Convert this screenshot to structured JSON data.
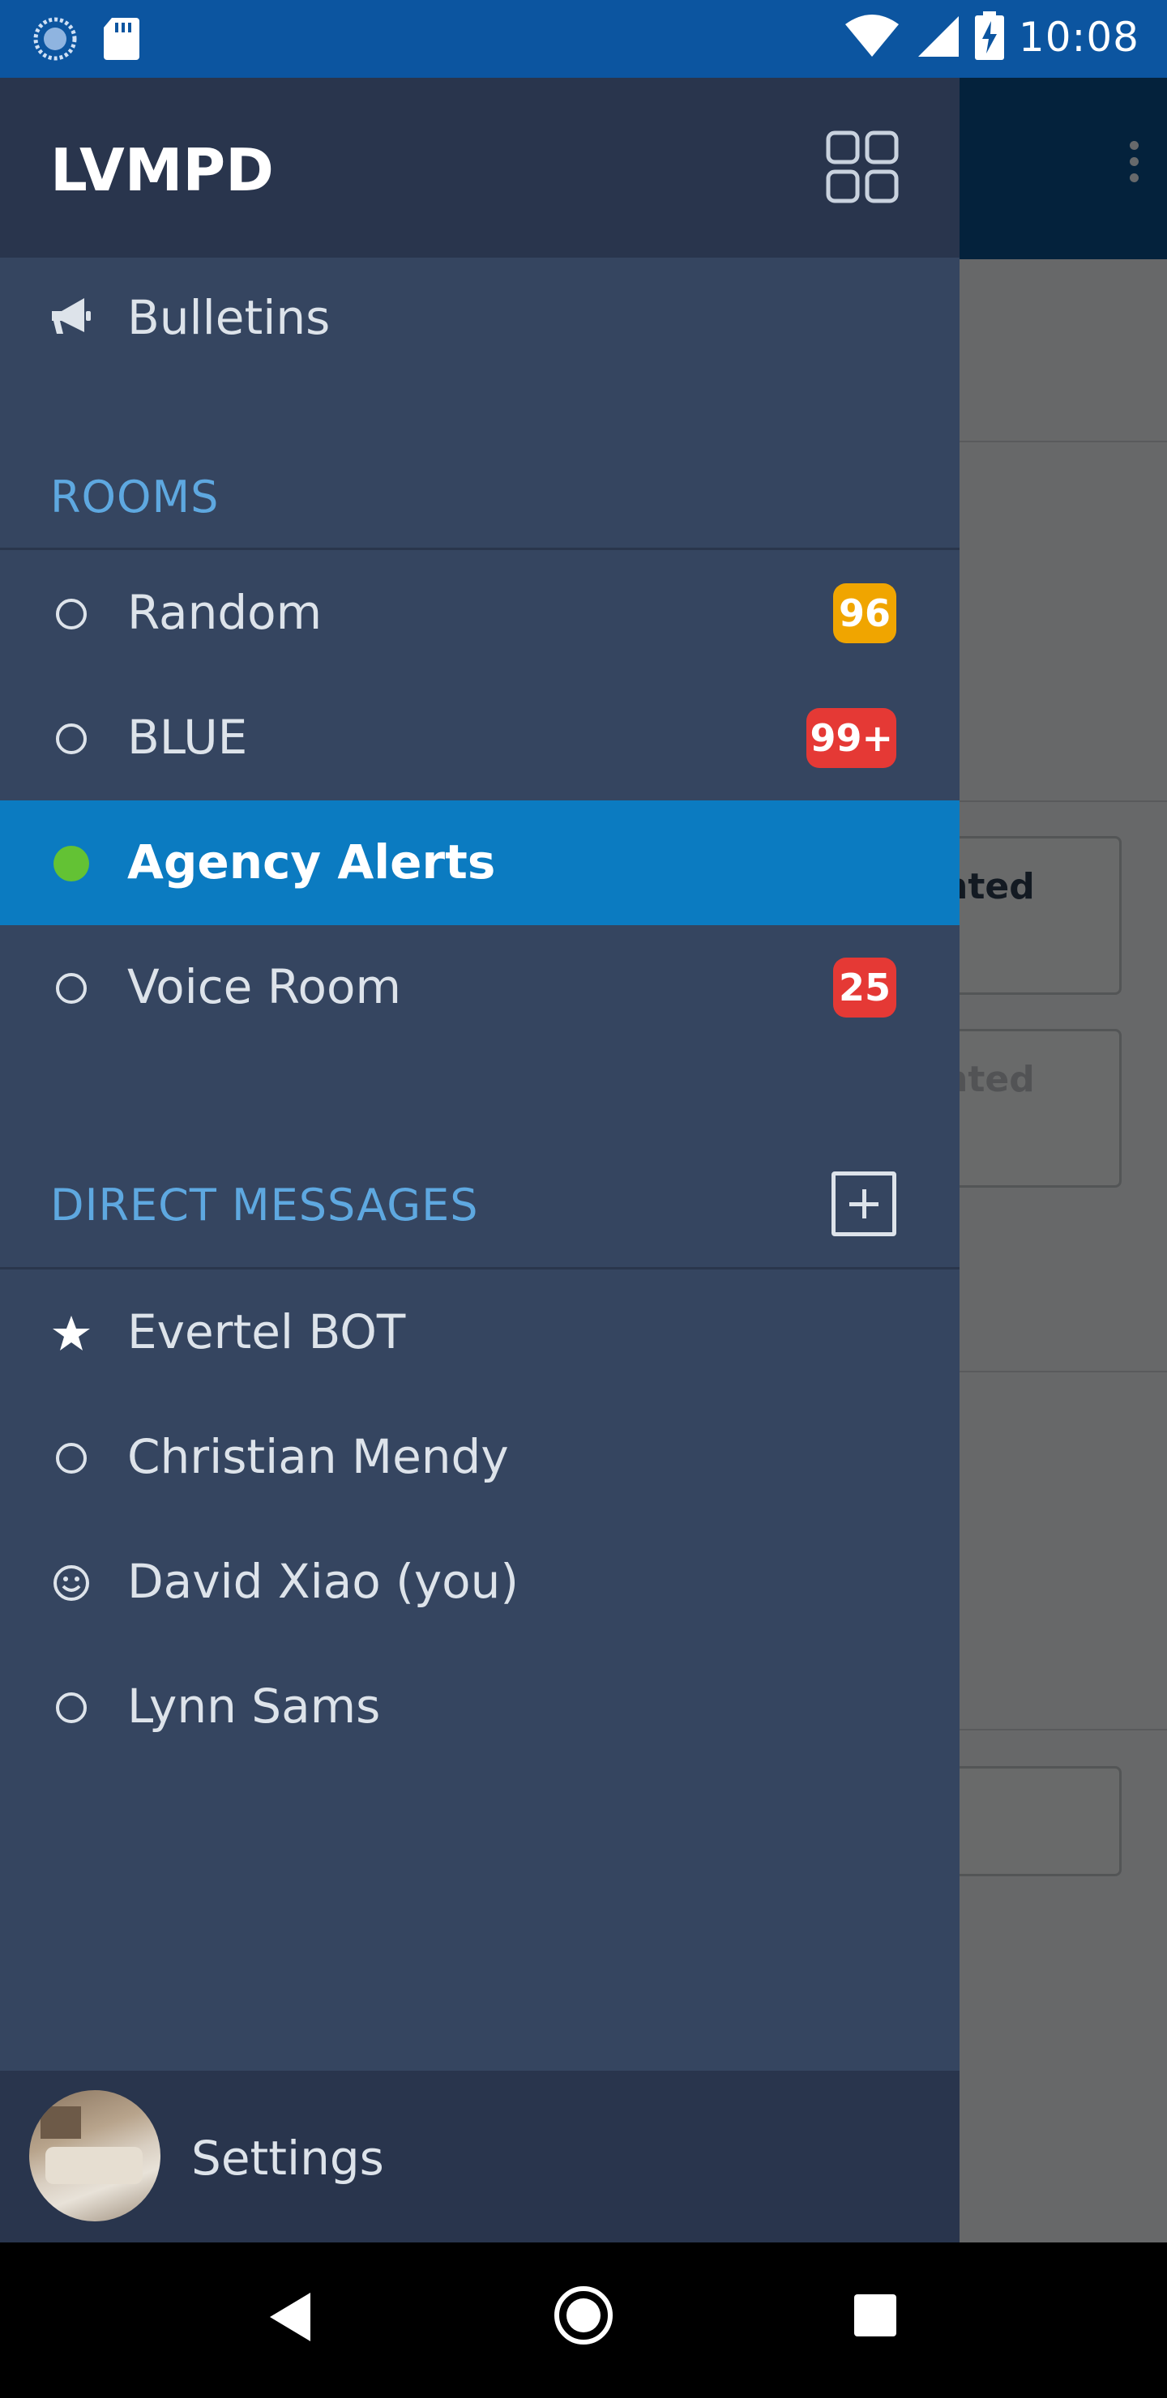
{
  "status_bar": {
    "time": "10:08",
    "icons": [
      "sync-icon",
      "sd-card-icon",
      "wifi-icon",
      "signal-icon",
      "battery-charging-icon"
    ]
  },
  "background": {
    "card_labels": [
      "nted",
      "nted"
    ]
  },
  "drawer": {
    "title": "LVMPD",
    "bulletins_label": "Bulletins",
    "rooms_header": "ROOMS",
    "rooms": [
      {
        "label": "Random",
        "badge": "96",
        "badge_color": "#f0a500",
        "active": false
      },
      {
        "label": "BLUE",
        "badge": "99+",
        "badge_color": "#e53935",
        "active": false
      },
      {
        "label": "Agency Alerts",
        "badge": "",
        "active": true,
        "status_color": "#63c234"
      },
      {
        "label": "Voice Room",
        "badge": "25",
        "badge_color": "#e53935",
        "active": false
      }
    ],
    "dm_header": "DIRECT MESSAGES",
    "direct_messages": [
      {
        "label": "Evertel BOT",
        "icon": "star-icon"
      },
      {
        "label": "Christian Mendy",
        "icon": "circle-outline-icon"
      },
      {
        "label": "David Xiao (you)",
        "icon": "smiley-icon"
      },
      {
        "label": "Lynn Sams",
        "icon": "circle-outline-icon"
      }
    ],
    "settings_label": "Settings"
  },
  "colors": {
    "drawer_bg": "#354560",
    "header_bg": "#29354d",
    "active_row": "#0b7bc1",
    "section_text": "#5ea8e0"
  }
}
